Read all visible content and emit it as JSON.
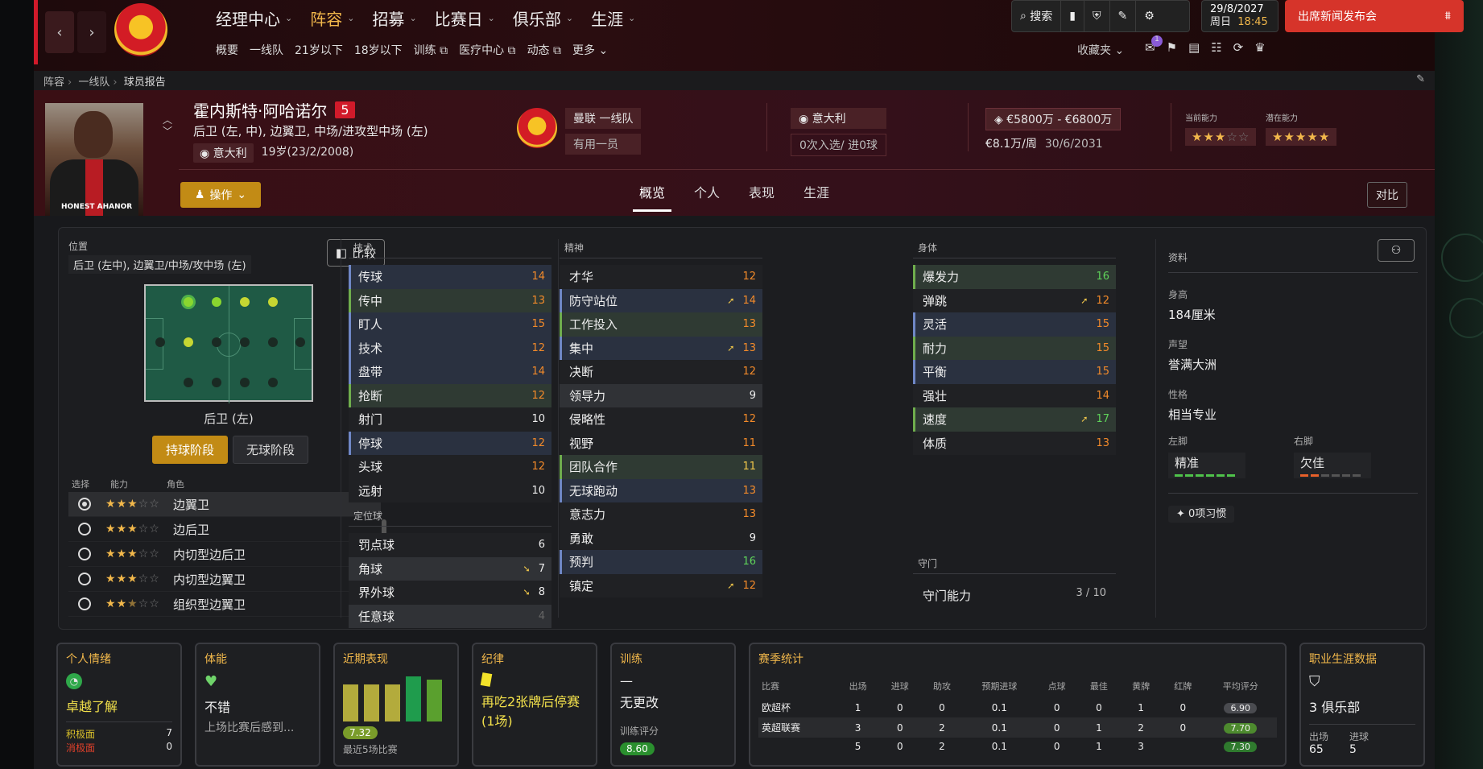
{
  "nav": {
    "back": "‹",
    "forward": "›",
    "club_crest": "MANCHESTER UNITED",
    "main": [
      {
        "label": "经理中心"
      },
      {
        "label": "阵容",
        "active": true
      },
      {
        "label": "招募"
      },
      {
        "label": "比赛日"
      },
      {
        "label": "俱乐部"
      },
      {
        "label": "生涯"
      }
    ],
    "sub": [
      "概要",
      "一线队",
      "21岁以下",
      "18岁以下",
      "训练 ⧉",
      "医疗中心 ⧉",
      "动态 ⧉",
      "更多 ⌄"
    ],
    "search_label": "搜索",
    "date": "29/8/2027",
    "weekday": "周日",
    "time": "18:45",
    "press_button": "出席新闻发布会",
    "favorites": "收藏夹",
    "notification_count": "1"
  },
  "breadcrumb": [
    "阵容",
    "一线队",
    "球员报告"
  ],
  "player": {
    "name": "霍内斯特·阿哈诺尔",
    "number": "5",
    "positions": "后卫 (左, 中), 边翼卫, 中场/进攻型中场 (左)",
    "nationality": "意大利",
    "age_dob": "19岁(23/2/2008)",
    "photo_caption": "HONEST AHANOR",
    "action_button": "操作",
    "club": "曼联 一线队",
    "squad_status": "有用一员",
    "intl_nation": "意大利",
    "intl_caps": "0次入选/ 进0球",
    "value_range": "€5800万 - €6800万",
    "wage": "€8.1万/周",
    "contract": "30/6/2031",
    "current_ability_label": "当前能力",
    "potential_ability_label": "潜在能力",
    "current_ability_stars": 3,
    "potential_ability_stars": 5
  },
  "tabs": [
    "概览",
    "个人",
    "表现",
    "生涯"
  ],
  "compare_button": "对比",
  "position_panel": {
    "label": "位置",
    "value": "后卫 (左中), 边翼卫/中场/攻中场 (左)",
    "compare_label": "比较",
    "selected_position": "后卫 (左)",
    "phase_in": "持球阶段",
    "phase_out": "无球阶段",
    "col_select": "选择",
    "col_ability": "能力",
    "col_role": "角色",
    "roles": [
      {
        "name": "边翼卫",
        "stars": 3,
        "selected": true
      },
      {
        "name": "边后卫",
        "stars": 3
      },
      {
        "name": "内切型边后卫",
        "stars": 3
      },
      {
        "name": "内切型边翼卫",
        "stars": 3
      },
      {
        "name": "组织型边翼卫",
        "stars": 2.5
      }
    ]
  },
  "attributes": {
    "technical_label": "技术",
    "technical": [
      {
        "name": "传球",
        "value": 14,
        "style": "bl",
        "color": "o"
      },
      {
        "name": "传中",
        "value": 13,
        "style": "hl",
        "color": "o"
      },
      {
        "name": "盯人",
        "value": 15,
        "style": "bl",
        "color": "o"
      },
      {
        "name": "技术",
        "value": 12,
        "style": "bl",
        "color": "o"
      },
      {
        "name": "盘带",
        "value": 14,
        "style": "bl",
        "color": "o"
      },
      {
        "name": "抢断",
        "value": 12,
        "style": "hl",
        "color": "o"
      },
      {
        "name": "射门",
        "value": 10,
        "style": "",
        "color": "w"
      },
      {
        "name": "停球",
        "value": 12,
        "style": "bl",
        "color": "o"
      },
      {
        "name": "头球",
        "value": 12,
        "style": "",
        "color": "o"
      },
      {
        "name": "远射",
        "value": 10,
        "style": "",
        "color": "w"
      }
    ],
    "setpiece_label": "定位球",
    "setpieces": [
      {
        "name": "罚点球",
        "value": 6,
        "style": "",
        "color": "w"
      },
      {
        "name": "角球",
        "value": 7,
        "style": "str",
        "color": "w",
        "arrow": "down"
      },
      {
        "name": "界外球",
        "value": 8,
        "style": "",
        "color": "w",
        "arrow": "down"
      },
      {
        "name": "任意球",
        "value": 4,
        "style": "str",
        "color": "d"
      }
    ],
    "mental_label": "精神",
    "mental": [
      {
        "name": "才华",
        "value": 12,
        "style": "",
        "color": "o"
      },
      {
        "name": "防守站位",
        "value": 14,
        "style": "bl",
        "color": "o",
        "arrow": "up"
      },
      {
        "name": "工作投入",
        "value": 13,
        "style": "hl",
        "color": "o"
      },
      {
        "name": "集中",
        "value": 13,
        "style": "bl",
        "color": "o",
        "arrow": "up"
      },
      {
        "name": "决断",
        "value": 12,
        "style": "",
        "color": "o"
      },
      {
        "name": "领导力",
        "value": 9,
        "style": "str",
        "color": "w"
      },
      {
        "name": "侵略性",
        "value": 12,
        "style": "",
        "color": "o"
      },
      {
        "name": "视野",
        "value": 11,
        "style": "",
        "color": "o"
      },
      {
        "name": "团队合作",
        "value": 11,
        "style": "hl",
        "color": "y"
      },
      {
        "name": "无球跑动",
        "value": 13,
        "style": "bl",
        "color": "o"
      },
      {
        "name": "意志力",
        "value": 13,
        "style": "",
        "color": "o"
      },
      {
        "name": "勇敢",
        "value": 9,
        "style": "",
        "color": "w"
      },
      {
        "name": "预判",
        "value": 16,
        "style": "bl",
        "color": "g"
      },
      {
        "name": "镇定",
        "value": 12,
        "style": "",
        "color": "o",
        "arrow": "up"
      }
    ],
    "physical_label": "身体",
    "physical": [
      {
        "name": "爆发力",
        "value": 16,
        "style": "hl",
        "color": "g"
      },
      {
        "name": "弹跳",
        "value": 12,
        "style": "",
        "color": "o",
        "arrow": "up"
      },
      {
        "name": "灵活",
        "value": 15,
        "style": "bl",
        "color": "o"
      },
      {
        "name": "耐力",
        "value": 15,
        "style": "hl",
        "color": "o"
      },
      {
        "name": "平衡",
        "value": 15,
        "style": "bl",
        "color": "o"
      },
      {
        "name": "强壮",
        "value": 14,
        "style": "",
        "color": "o"
      },
      {
        "name": "速度",
        "value": 17,
        "style": "hl",
        "color": "g",
        "arrow": "up"
      },
      {
        "name": "体质",
        "value": 13,
        "style": "",
        "color": "o"
      }
    ],
    "gk_label": "守门",
    "gk_name": "守门能力",
    "gk_value": "3 / 10"
  },
  "info": {
    "label": "资料",
    "height_label": "身高",
    "height": "184厘米",
    "reputation_label": "声望",
    "reputation": "誉满大洲",
    "personality_label": "性格",
    "personality": "相当专业",
    "left_foot_label": "左脚",
    "left_foot": "精准",
    "right_foot_label": "右脚",
    "right_foot": "欠佳",
    "habits": "0项习惯"
  },
  "cards": {
    "morale": {
      "title": "个人情绪",
      "value": "卓越了解",
      "pos_label": "积极面",
      "pos": "7",
      "neg_label": "消极面",
      "neg": "0"
    },
    "fitness": {
      "title": "体能",
      "value": "不错",
      "sub": "上场比赛后感到..."
    },
    "form": {
      "title": "近期表现",
      "rating": "7.32",
      "sub": "最近5场比赛"
    },
    "discipline": {
      "title": "纪律",
      "value": "再吃2张牌后停赛\n(1场)"
    },
    "training": {
      "title": "训练",
      "value": "—",
      "sub": "无更改",
      "rating_label": "训练评分",
      "rating": "8.60"
    },
    "season": {
      "title": "赛季统计",
      "headers": [
        "比赛",
        "出场",
        "进球",
        "助攻",
        "预期进球",
        "点球",
        "最佳",
        "黄牌",
        "红牌",
        "平均评分"
      ],
      "rows": [
        [
          "欧超杯",
          "1",
          "0",
          "0",
          "0.1",
          "0",
          "0",
          "1",
          "0",
          "6.90"
        ],
        [
          "英超联赛",
          "3",
          "0",
          "2",
          "0.1",
          "0",
          "1",
          "2",
          "0",
          "7.70"
        ],
        [
          "",
          "5",
          "0",
          "2",
          "0.1",
          "0",
          "1",
          "3",
          "",
          "7.30"
        ]
      ]
    },
    "career": {
      "title": "职业生涯数据",
      "clubs": "3 俱乐部",
      "apps_label": "出场",
      "apps": "65",
      "goals_label": "进球",
      "goals": "5"
    }
  }
}
